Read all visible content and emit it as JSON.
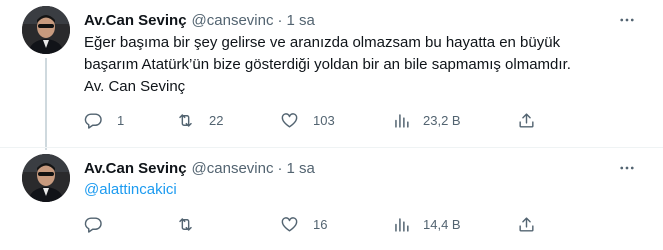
{
  "tweets": [
    {
      "author": {
        "name": "Av.Can Sevinç",
        "handle": "@cansevinc",
        "separator": "·",
        "time": "1 sa"
      },
      "text_lines": [
        "Eğer başıma bir şey gelirse ve aranızda olmazsam bu hayatta en büyük",
        "başarım Atatürk’ün bize gösterdiği yoldan bir an bile sapmamış olmamdır.",
        "Av. Can Sevinç"
      ],
      "stats": {
        "replies": "1",
        "retweets": "22",
        "likes": "103",
        "views": "23,2 B"
      }
    },
    {
      "author": {
        "name": "Av.Can Sevinç",
        "handle": "@cansevinc",
        "separator": "·",
        "time": "1 sa"
      },
      "mention": "@alattincakici",
      "stats": {
        "replies": "",
        "retweets": "",
        "likes": "16",
        "views": "14,4 B"
      }
    }
  ],
  "icons": {
    "more": "more-horizontal-icon",
    "reply": "reply-icon",
    "retweet": "retweet-icon",
    "like": "heart-icon",
    "views": "views-chart-icon",
    "share": "share-icon"
  },
  "colors": {
    "text": "#0f1419",
    "secondary": "#536471",
    "link": "#1d9bf0",
    "divider": "#eff3f4",
    "thread_line": "#cfd9de"
  }
}
